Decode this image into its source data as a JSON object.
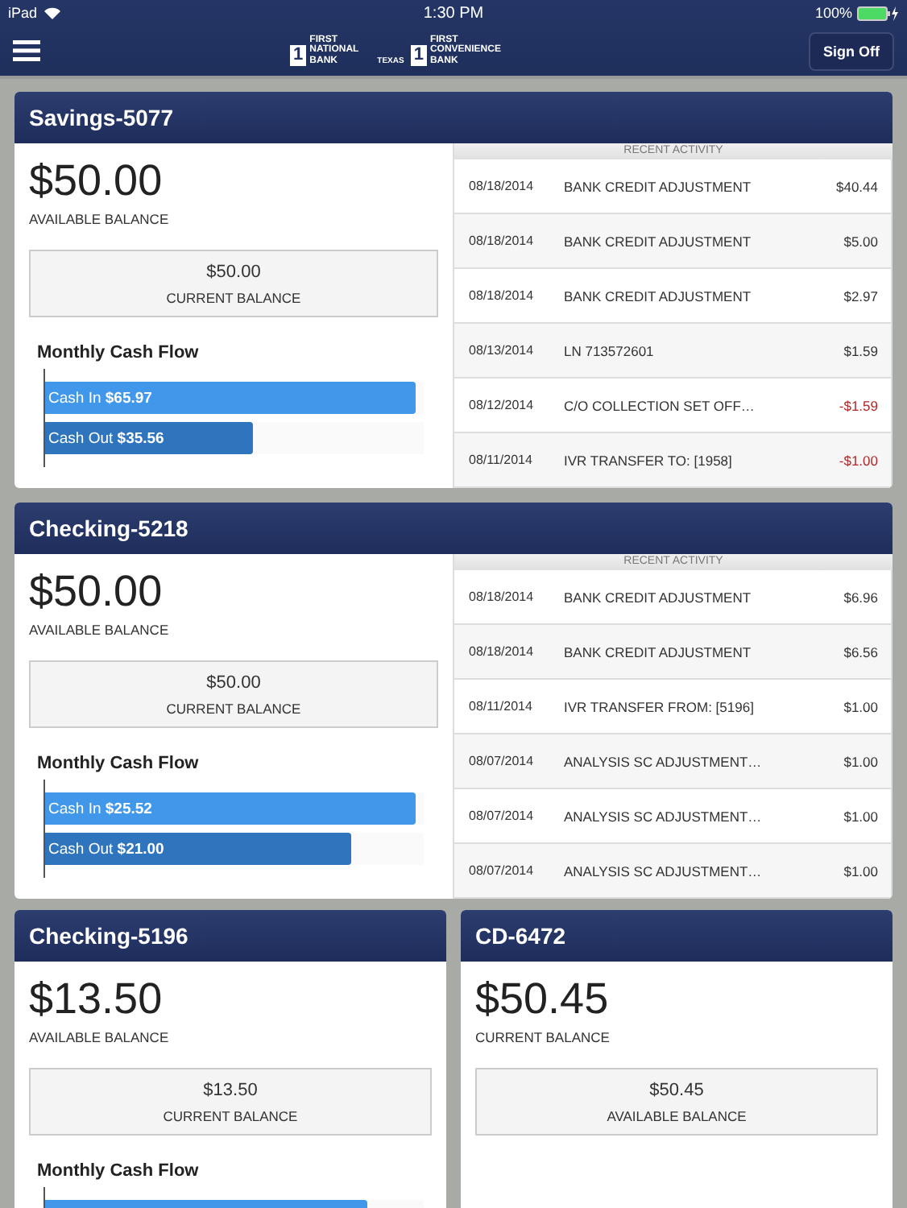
{
  "status_bar": {
    "device": "iPad",
    "time": "1:30 PM",
    "battery": "100%"
  },
  "nav": {
    "logos": [
      {
        "mark": "1",
        "name": "FIRST NATIONAL BANK",
        "suffix": "TEXAS"
      },
      {
        "mark": "1",
        "name": "FIRST CONVENIENCE BANK"
      }
    ],
    "sign_off": "Sign Off"
  },
  "accounts": [
    {
      "title": "Savings-5077",
      "balance": "$50.00",
      "balance_label": "AVAILABLE BALANCE",
      "second": "$50.00",
      "second_label": "CURRENT BALANCE",
      "cash_flow": {
        "title": "Monthly Cash Flow",
        "bars": [
          {
            "kind": "in",
            "label": "Cash In",
            "amount": "$65.97",
            "level": 0.98
          },
          {
            "kind": "out",
            "label": "Cash Out",
            "amount": "$35.56",
            "level": 0.55
          }
        ]
      },
      "activity": {
        "title": "RECENT ACTIVITY",
        "rows": [
          {
            "date": "08/18/2014",
            "description": "BANK CREDIT ADJUSTMENT",
            "amount": "$40.44",
            "negative": false
          },
          {
            "date": "08/18/2014",
            "description": "BANK CREDIT ADJUSTMENT",
            "amount": "$5.00",
            "negative": false
          },
          {
            "date": "08/18/2014",
            "description": "BANK CREDIT ADJUSTMENT",
            "amount": "$2.97",
            "negative": false
          },
          {
            "date": "08/13/2014",
            "description": "LN 713572601",
            "amount": "$1.59",
            "negative": false
          },
          {
            "date": "08/12/2014",
            "description": "C/O COLLECTION SET OFF…",
            "amount": "-$1.59",
            "negative": true
          },
          {
            "date": "08/11/2014",
            "description": "IVR TRANSFER TO: [1958]",
            "amount": "-$1.00",
            "negative": true
          }
        ]
      }
    },
    {
      "title": "Checking-5218",
      "balance": "$50.00",
      "balance_label": "AVAILABLE BALANCE",
      "second": "$50.00",
      "second_label": "CURRENT BALANCE",
      "cash_flow": {
        "title": "Monthly Cash Flow",
        "bars": [
          {
            "kind": "in",
            "label": "Cash In",
            "amount": "$25.52",
            "level": 0.98
          },
          {
            "kind": "out",
            "label": "Cash Out",
            "amount": "$21.00",
            "level": 0.81
          }
        ]
      },
      "activity": {
        "title": "RECENT ACTIVITY",
        "rows": [
          {
            "date": "08/18/2014",
            "description": "BANK CREDIT ADJUSTMENT",
            "amount": "$6.96",
            "negative": false
          },
          {
            "date": "08/18/2014",
            "description": "BANK CREDIT ADJUSTMENT",
            "amount": "$6.56",
            "negative": false
          },
          {
            "date": "08/11/2014",
            "description": "IVR TRANSFER FROM: [5196]",
            "amount": "$1.00",
            "negative": false
          },
          {
            "date": "08/07/2014",
            "description": "ANALYSIS SC ADJUSTMENT…",
            "amount": "$1.00",
            "negative": false
          },
          {
            "date": "08/07/2014",
            "description": "ANALYSIS SC ADJUSTMENT…",
            "amount": "$1.00",
            "negative": false
          },
          {
            "date": "08/07/2014",
            "description": "ANALYSIS SC ADJUSTMENT…",
            "amount": "$1.00",
            "negative": false
          }
        ]
      }
    },
    {
      "title": "Checking-5196",
      "balance": "$13.50",
      "balance_label": "AVAILABLE BALANCE",
      "second": "$13.50",
      "second_label": "CURRENT BALANCE",
      "cash_flow": {
        "title": "Monthly Cash Flow",
        "bars": [
          {
            "kind": "in",
            "level": 0.85
          }
        ]
      }
    },
    {
      "title": "CD-6472",
      "balance": "$50.45",
      "balance_label": "CURRENT BALANCE",
      "second": "$50.45",
      "second_label": "AVAILABLE BALANCE"
    }
  ]
}
